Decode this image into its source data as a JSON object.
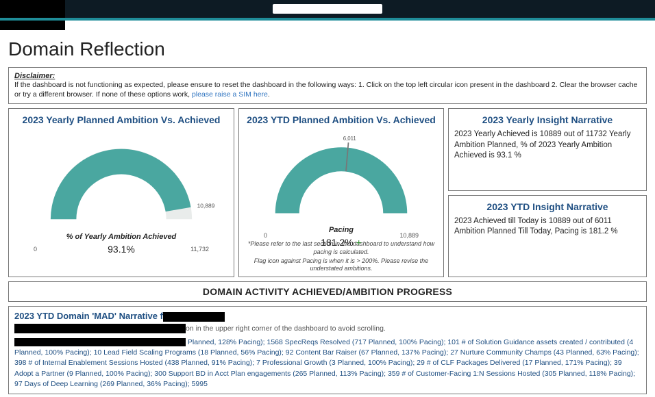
{
  "page_title": "Domain Reflection",
  "disclaimer": {
    "label": "Disclaimer:",
    "text_a": "If the dashboard is not functioning as expected, please ensure to reset the dashboard in the following ways: 1. Click on the top left circular icon present in the dashboard 2. Clear the browser cache or try a different browser. If none of these options work, ",
    "link": "please raise a SIM here",
    "text_b": "."
  },
  "gauge1": {
    "title": "2023 Yearly Planned Ambition Vs. Achieved",
    "sub": "% of Yearly Ambition Achieved",
    "value": "93.1%",
    "left_tick": "0",
    "right_tick": "11,732",
    "mid_label": "10,889"
  },
  "gauge2": {
    "title": "2023 YTD Planned Ambition Vs. Achieved",
    "sub": "Pacing",
    "value": "181.2%",
    "plus": "+",
    "top_label": "6,011",
    "left_tick": "0",
    "right_tick": "10,889",
    "note1": "*Please refer to the last section in this dashboard to understand how pacing is calculated.",
    "note2": "Flag icon against Pacing is when it is > 200%. Please revise the understated ambitions."
  },
  "insight_yearly": {
    "title": "2023 Yearly Insight Narrative",
    "body": "2023 Yearly Achieved is 10889 out of 11732 Yearly Ambition Planned, % of 2023 Yearly Ambition Achieved is 93.1 %"
  },
  "insight_ytd": {
    "title": "2023 YTD Insight Narrative",
    "body": "2023 Achieved till Today is 10889 out of 6011 Ambition Planned Till Today, Pacing is 181.2 %"
  },
  "section_header": "DOMAIN ACTIVITY ACHIEVED/AMBITION PROGRESS",
  "mad": {
    "title_prefix": "2023 YTD Domain 'MAD' Narrative f",
    "hint_suffix": "on in the upper right corner of the dashboard to avoid scrolling.",
    "body": " Planned, 128% Pacing); 1568 SpecReqs Resolved (717  Planned, 100% Pacing); 101 # of Solution Guidance assets created / contributed (4  Planned, 100% Pacing); 10 Lead Field Scaling Programs (18  Planned, 56% Pacing); 92 Content Bar Raiser (67  Planned, 137% Pacing); 27 Nurture Community Champs (43  Planned, 63% Pacing); 398 # of Internal Enablement Sessions Hosted (438  Planned, 91% Pacing); 7 Professional Growth (3  Planned, 100% Pacing); 29 # of CLF Packages Delivered (17  Planned, 171% Pacing); 39 Adopt a Partner (9  Planned, 100% Pacing); 300 Support BD in Acct Plan engagements (265  Planned, 113% Pacing); 359 # of Customer-Facing 1:N Sessions Hosted (305  Planned, 118% Pacing); 97 Days of Deep Learning (269  Planned, 36% Pacing); 5995"
  },
  "chart_data": [
    {
      "type": "gauge",
      "title": "2023 Yearly Planned Ambition Vs. Achieved",
      "metric": "% of Yearly Ambition Achieved",
      "value_pct": 93.1,
      "achieved": 10889,
      "planned": 11732,
      "range": [
        0,
        11732
      ]
    },
    {
      "type": "gauge",
      "title": "2023 YTD Planned Ambition Vs. Achieved",
      "metric": "Pacing",
      "value_pct": 181.2,
      "achieved": 10889,
      "planned_ytd": 6011,
      "range": [
        0,
        10889
      ]
    }
  ]
}
